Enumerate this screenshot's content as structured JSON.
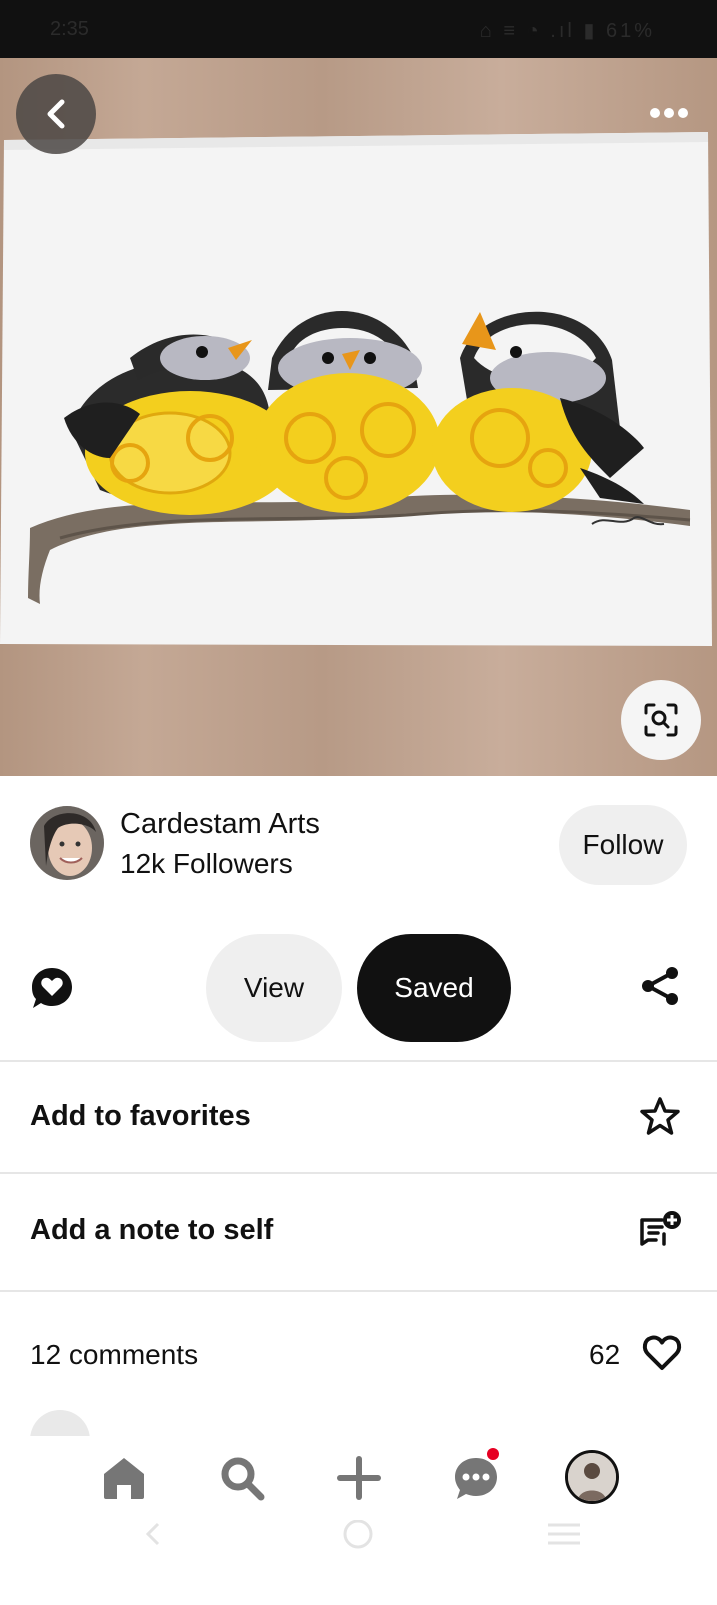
{
  "status_bar": {
    "time": "2:35",
    "icons": "⌂ ≡ ◔ .ıl ▮ 61%"
  },
  "hero": {
    "image_alt": "Paper quilling art of three yellow and black birds on a branch",
    "back_icon": "chevron-left-icon",
    "more_icon": "more-horizontal-icon",
    "lens_icon": "visual-search-icon"
  },
  "creator": {
    "name": "Cardestam Arts",
    "followers": "12k Followers",
    "follow_label": "Follow"
  },
  "actions": {
    "view_label": "View",
    "saved_label": "Saved"
  },
  "options": [
    {
      "label": "Add to favorites",
      "icon": "star-icon"
    },
    {
      "label": "Add a note to self",
      "icon": "note-add-icon"
    }
  ],
  "comments": {
    "count_label": "12 comments",
    "likes": "62"
  },
  "bottom_nav": [
    "home-icon",
    "search-icon",
    "create-icon",
    "messages-icon",
    "profile-icon"
  ],
  "colors": {
    "accent": "#111111",
    "notification": "#e60023",
    "button_bg": "#efefef"
  }
}
